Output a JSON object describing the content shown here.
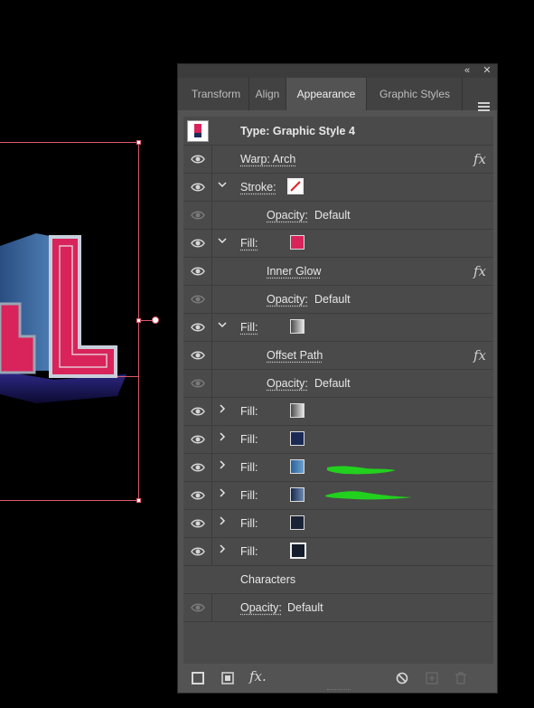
{
  "panel": {
    "collapse_glyph": "«",
    "close_glyph": "✕",
    "tabs": [
      {
        "label": "Transform",
        "active": false
      },
      {
        "label": "Align",
        "active": false
      },
      {
        "label": "Appearance",
        "active": true
      },
      {
        "label": "Graphic Styles",
        "active": false
      }
    ],
    "menu_icon": "hamburger-menu-icon"
  },
  "appearance": {
    "type_label": "Type: Graphic Style 4",
    "fx_glyph": "fx",
    "rows": [
      {
        "kind": "effect",
        "label": "Warp: Arch",
        "visible": true,
        "fx": true
      },
      {
        "kind": "stroke",
        "label": "Stroke:",
        "visible": true,
        "expanded": true,
        "swatch": "none-red-slash"
      },
      {
        "kind": "opacity",
        "label": "Opacity:",
        "value": "Default",
        "visible": false,
        "indent": true
      },
      {
        "kind": "fill",
        "label": "Fill:",
        "visible": true,
        "expanded": true,
        "swatch": "#d8245a"
      },
      {
        "kind": "effect",
        "label": "Inner Glow",
        "visible": true,
        "fx": true,
        "indent": true
      },
      {
        "kind": "opacity",
        "label": "Opacity:",
        "value": "Default",
        "visible": false,
        "indent": true
      },
      {
        "kind": "fill",
        "label": "Fill:",
        "visible": true,
        "expanded": true,
        "swatch": "gradient-gray"
      },
      {
        "kind": "effect",
        "label": "Offset Path",
        "visible": true,
        "fx": true,
        "indent": true
      },
      {
        "kind": "opacity",
        "label": "Opacity:",
        "value": "Default",
        "visible": false,
        "indent": true
      },
      {
        "kind": "fill",
        "label": "Fill:",
        "visible": true,
        "expanded": false,
        "swatch": "gradient-gray"
      },
      {
        "kind": "fill",
        "label": "Fill:",
        "visible": true,
        "expanded": false,
        "swatch": "#1a2a55"
      },
      {
        "kind": "fill",
        "label": "Fill:",
        "visible": true,
        "expanded": false,
        "swatch": "gradient-blue"
      },
      {
        "kind": "fill",
        "label": "Fill:",
        "visible": true,
        "expanded": false,
        "swatch": "gradient-navy"
      },
      {
        "kind": "fill",
        "label": "Fill:",
        "visible": true,
        "expanded": false,
        "swatch": "#1b2437"
      },
      {
        "kind": "fill",
        "label": "Fill:",
        "visible": true,
        "expanded": false,
        "swatch": "#151c2b"
      },
      {
        "kind": "characters",
        "label": "Characters"
      },
      {
        "kind": "opacity",
        "label": "Opacity:",
        "value": "Default",
        "visible": false,
        "indent": false
      }
    ]
  },
  "footer": {
    "icons": [
      "add-new-stroke-icon",
      "add-new-fill-icon",
      "add-new-effect-icon",
      "clear-appearance-icon",
      "duplicate-item-icon",
      "delete-item-icon"
    ],
    "fx_label": "fx."
  },
  "colors": {
    "accent_selection": "#e05a6a",
    "annotation_green": "#22d11e",
    "letter_red": "#d8245a"
  }
}
